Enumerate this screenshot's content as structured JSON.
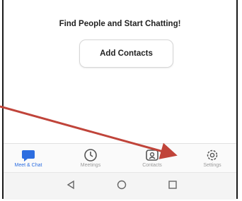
{
  "main": {
    "headline": "Find People and Start Chatting!",
    "add_contacts_label": "Add Contacts"
  },
  "tabbar": {
    "tabs": [
      {
        "label": "Meet & Chat",
        "icon": "chat-bubble-icon",
        "active": true
      },
      {
        "label": "Meetings",
        "icon": "clock-icon",
        "active": false
      },
      {
        "label": "Contacts",
        "icon": "contacts-icon",
        "active": false
      },
      {
        "label": "Settings",
        "icon": "gear-icon",
        "active": false
      }
    ]
  },
  "navbar": {
    "buttons": [
      "back-triangle-icon",
      "home-circle-icon",
      "recents-square-icon"
    ]
  },
  "colors": {
    "accent": "#2d6ee0",
    "inactive": "#9a9a9a",
    "annotation_arrow": "#c0443a"
  }
}
